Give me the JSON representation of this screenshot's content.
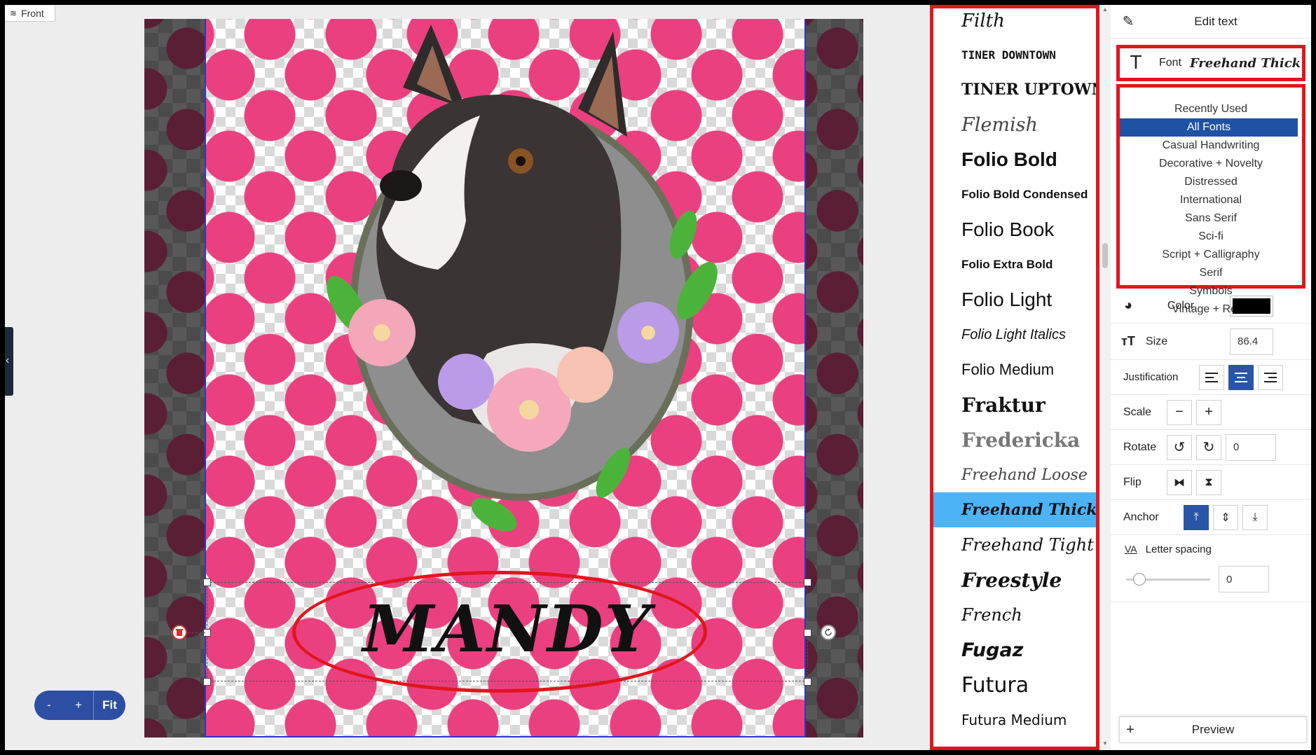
{
  "view_tag": {
    "label": "Front",
    "icon": "layers-icon"
  },
  "canvas": {
    "text_element": "MANDY",
    "colors": {
      "workspace_bg": "#585858",
      "dot_pink": "#ea4080",
      "selection_red": "#e2151d"
    }
  },
  "zoom": {
    "minus": "-",
    "plus": "+",
    "fit": "Fit"
  },
  "font_list": {
    "items": [
      {
        "label": "Filth",
        "selected": false
      },
      {
        "label": "TINER DOWNTOWN",
        "selected": false
      },
      {
        "label": "TINER UPTOWN",
        "selected": false
      },
      {
        "label": "Flemish",
        "selected": false
      },
      {
        "label": "Folio Bold",
        "selected": false
      },
      {
        "label": "Folio Bold Condensed",
        "selected": false
      },
      {
        "label": "Folio Book",
        "selected": false
      },
      {
        "label": "Folio Extra Bold",
        "selected": false
      },
      {
        "label": "Folio Light",
        "selected": false
      },
      {
        "label": "Folio Light Italics",
        "selected": false
      },
      {
        "label": "Folio Medium",
        "selected": false
      },
      {
        "label": "Fraktur",
        "selected": false
      },
      {
        "label": "Fredericka",
        "selected": false
      },
      {
        "label": "Freehand Loose",
        "selected": false
      },
      {
        "label": "Freehand Thick",
        "selected": true
      },
      {
        "label": "Freehand Tight",
        "selected": false
      },
      {
        "label": "Freestyle",
        "selected": false
      },
      {
        "label": "French",
        "selected": false
      },
      {
        "label": "Fugaz",
        "selected": false
      },
      {
        "label": "Futura",
        "selected": false
      },
      {
        "label": "Futura Medium",
        "selected": false
      }
    ]
  },
  "edit_panel": {
    "title": "Edit text",
    "font": {
      "label": "Font",
      "value": "Freehand Thick"
    },
    "categories": [
      "Recently Used",
      "All Fonts",
      "Casual Handwriting",
      "Decorative + Novelty",
      "Distressed",
      "International",
      "Sans Serif",
      "Sci-fi",
      "Script + Calligraphy",
      "Serif",
      "Symbols",
      "Vintage + Retro"
    ],
    "selected_category": "All Fonts",
    "color": {
      "label": "Color",
      "value": "#000000"
    },
    "size": {
      "label": "Size",
      "value": "86.4"
    },
    "justification": {
      "label": "Justification",
      "selected": "center"
    },
    "scale": {
      "label": "Scale"
    },
    "rotate": {
      "label": "Rotate",
      "value": "0"
    },
    "flip": {
      "label": "Flip"
    },
    "anchor": {
      "label": "Anchor",
      "selected": "top"
    },
    "letter_spacing": {
      "icon_label": "VA",
      "label": "Letter spacing",
      "value": "0",
      "slider": 0.1
    },
    "preview": {
      "label": "Preview",
      "plus": "+"
    }
  }
}
